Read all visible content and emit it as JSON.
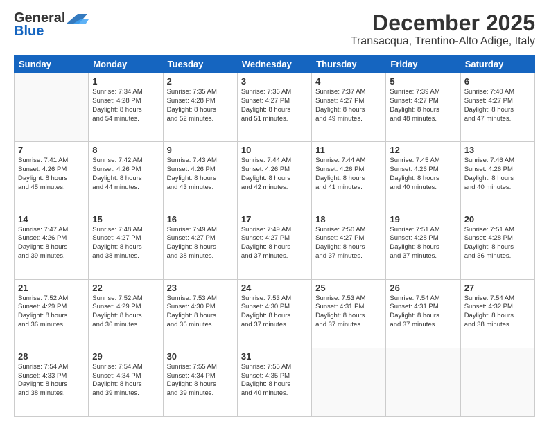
{
  "logo": {
    "line1": "General",
    "line2": "Blue"
  },
  "title": "December 2025",
  "subtitle": "Transacqua, Trentino-Alto Adige, Italy",
  "days_of_week": [
    "Sunday",
    "Monday",
    "Tuesday",
    "Wednesday",
    "Thursday",
    "Friday",
    "Saturday"
  ],
  "weeks": [
    [
      {
        "day": "",
        "info": ""
      },
      {
        "day": "1",
        "info": "Sunrise: 7:34 AM\nSunset: 4:28 PM\nDaylight: 8 hours\nand 54 minutes."
      },
      {
        "day": "2",
        "info": "Sunrise: 7:35 AM\nSunset: 4:28 PM\nDaylight: 8 hours\nand 52 minutes."
      },
      {
        "day": "3",
        "info": "Sunrise: 7:36 AM\nSunset: 4:27 PM\nDaylight: 8 hours\nand 51 minutes."
      },
      {
        "day": "4",
        "info": "Sunrise: 7:37 AM\nSunset: 4:27 PM\nDaylight: 8 hours\nand 49 minutes."
      },
      {
        "day": "5",
        "info": "Sunrise: 7:39 AM\nSunset: 4:27 PM\nDaylight: 8 hours\nand 48 minutes."
      },
      {
        "day": "6",
        "info": "Sunrise: 7:40 AM\nSunset: 4:27 PM\nDaylight: 8 hours\nand 47 minutes."
      }
    ],
    [
      {
        "day": "7",
        "info": "Sunrise: 7:41 AM\nSunset: 4:26 PM\nDaylight: 8 hours\nand 45 minutes."
      },
      {
        "day": "8",
        "info": "Sunrise: 7:42 AM\nSunset: 4:26 PM\nDaylight: 8 hours\nand 44 minutes."
      },
      {
        "day": "9",
        "info": "Sunrise: 7:43 AM\nSunset: 4:26 PM\nDaylight: 8 hours\nand 43 minutes."
      },
      {
        "day": "10",
        "info": "Sunrise: 7:44 AM\nSunset: 4:26 PM\nDaylight: 8 hours\nand 42 minutes."
      },
      {
        "day": "11",
        "info": "Sunrise: 7:44 AM\nSunset: 4:26 PM\nDaylight: 8 hours\nand 41 minutes."
      },
      {
        "day": "12",
        "info": "Sunrise: 7:45 AM\nSunset: 4:26 PM\nDaylight: 8 hours\nand 40 minutes."
      },
      {
        "day": "13",
        "info": "Sunrise: 7:46 AM\nSunset: 4:26 PM\nDaylight: 8 hours\nand 40 minutes."
      }
    ],
    [
      {
        "day": "14",
        "info": "Sunrise: 7:47 AM\nSunset: 4:26 PM\nDaylight: 8 hours\nand 39 minutes."
      },
      {
        "day": "15",
        "info": "Sunrise: 7:48 AM\nSunset: 4:27 PM\nDaylight: 8 hours\nand 38 minutes."
      },
      {
        "day": "16",
        "info": "Sunrise: 7:49 AM\nSunset: 4:27 PM\nDaylight: 8 hours\nand 38 minutes."
      },
      {
        "day": "17",
        "info": "Sunrise: 7:49 AM\nSunset: 4:27 PM\nDaylight: 8 hours\nand 37 minutes."
      },
      {
        "day": "18",
        "info": "Sunrise: 7:50 AM\nSunset: 4:27 PM\nDaylight: 8 hours\nand 37 minutes."
      },
      {
        "day": "19",
        "info": "Sunrise: 7:51 AM\nSunset: 4:28 PM\nDaylight: 8 hours\nand 37 minutes."
      },
      {
        "day": "20",
        "info": "Sunrise: 7:51 AM\nSunset: 4:28 PM\nDaylight: 8 hours\nand 36 minutes."
      }
    ],
    [
      {
        "day": "21",
        "info": "Sunrise: 7:52 AM\nSunset: 4:29 PM\nDaylight: 8 hours\nand 36 minutes."
      },
      {
        "day": "22",
        "info": "Sunrise: 7:52 AM\nSunset: 4:29 PM\nDaylight: 8 hours\nand 36 minutes."
      },
      {
        "day": "23",
        "info": "Sunrise: 7:53 AM\nSunset: 4:30 PM\nDaylight: 8 hours\nand 36 minutes."
      },
      {
        "day": "24",
        "info": "Sunrise: 7:53 AM\nSunset: 4:30 PM\nDaylight: 8 hours\nand 37 minutes."
      },
      {
        "day": "25",
        "info": "Sunrise: 7:53 AM\nSunset: 4:31 PM\nDaylight: 8 hours\nand 37 minutes."
      },
      {
        "day": "26",
        "info": "Sunrise: 7:54 AM\nSunset: 4:31 PM\nDaylight: 8 hours\nand 37 minutes."
      },
      {
        "day": "27",
        "info": "Sunrise: 7:54 AM\nSunset: 4:32 PM\nDaylight: 8 hours\nand 38 minutes."
      }
    ],
    [
      {
        "day": "28",
        "info": "Sunrise: 7:54 AM\nSunset: 4:33 PM\nDaylight: 8 hours\nand 38 minutes."
      },
      {
        "day": "29",
        "info": "Sunrise: 7:54 AM\nSunset: 4:34 PM\nDaylight: 8 hours\nand 39 minutes."
      },
      {
        "day": "30",
        "info": "Sunrise: 7:55 AM\nSunset: 4:34 PM\nDaylight: 8 hours\nand 39 minutes."
      },
      {
        "day": "31",
        "info": "Sunrise: 7:55 AM\nSunset: 4:35 PM\nDaylight: 8 hours\nand 40 minutes."
      },
      {
        "day": "",
        "info": ""
      },
      {
        "day": "",
        "info": ""
      },
      {
        "day": "",
        "info": ""
      }
    ]
  ]
}
